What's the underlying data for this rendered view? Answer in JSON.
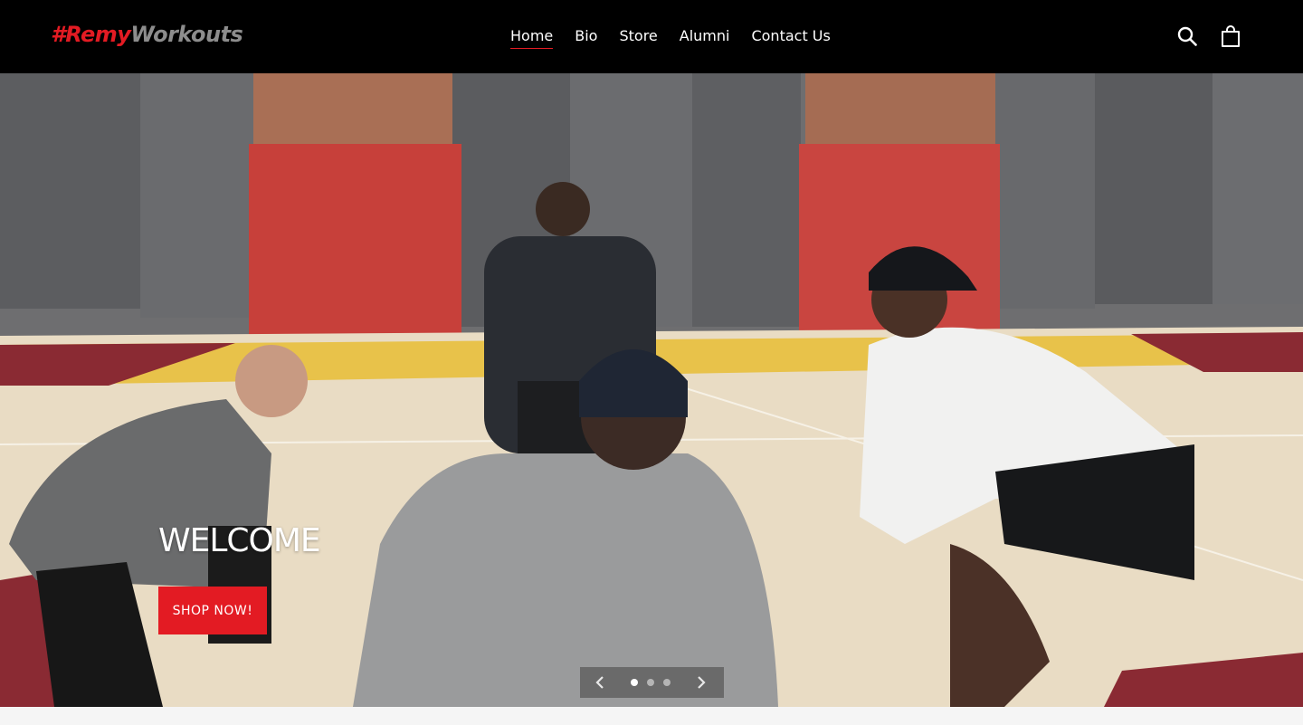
{
  "header": {
    "logo": {
      "hash": "#",
      "part1": "Remy",
      "part2": "Workouts"
    },
    "nav": [
      {
        "label": "Home",
        "active": true
      },
      {
        "label": "Bio",
        "active": false
      },
      {
        "label": "Store",
        "active": false
      },
      {
        "label": "Alumni",
        "active": false
      },
      {
        "label": "Contact Us",
        "active": false
      }
    ],
    "icons": {
      "search": "search-icon",
      "cart": "shopping-bag-icon"
    }
  },
  "hero": {
    "heading": "WELCOME",
    "button_label": "SHOP NOW!",
    "slides_total": 3,
    "active_slide": 1
  },
  "colors": {
    "accent": "#e31b23",
    "header_bg": "#000000",
    "page_bg": "#f5f5f5"
  }
}
